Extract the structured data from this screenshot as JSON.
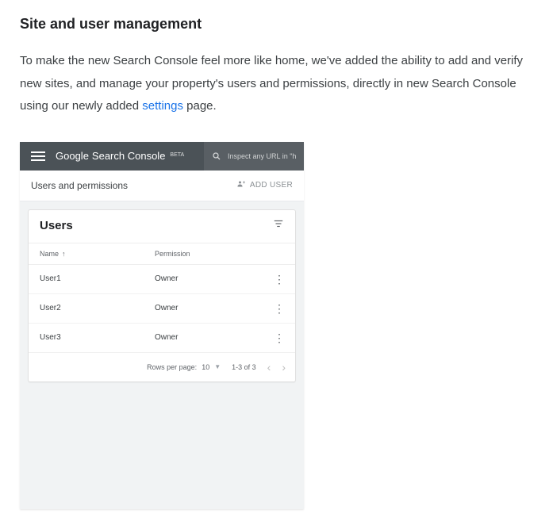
{
  "article": {
    "heading": "Site and user management",
    "paragraph_before_link": "To make the new Search Console feel more like home, we've added the ability to add and verify new sites, and manage your property's users and permissions, directly in new Search Console using our newly added ",
    "link_text": "settings",
    "paragraph_after_link": " page."
  },
  "app": {
    "brand_bold": "Google",
    "brand_light": "Search Console",
    "beta": "BETA",
    "search_placeholder": "Inspect any URL in \"htt",
    "subbar_title": "Users and permissions",
    "add_user_label": "ADD USER",
    "card_title": "Users",
    "columns": {
      "name": "Name",
      "permission": "Permission"
    },
    "rows": [
      {
        "name": "User1",
        "permission": "Owner"
      },
      {
        "name": "User2",
        "permission": "Owner"
      },
      {
        "name": "User3",
        "permission": "Owner"
      }
    ],
    "footer": {
      "rows_per_page_label": "Rows per page:",
      "rows_per_page_value": "10",
      "range": "1-3 of 3"
    }
  }
}
